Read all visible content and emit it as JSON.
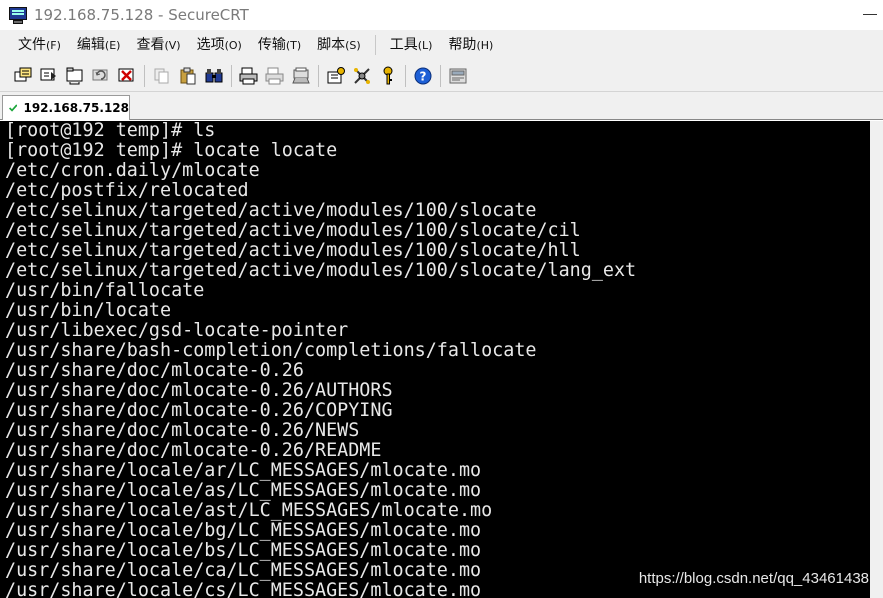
{
  "window": {
    "title": "192.168.75.128 - SecureCRT",
    "icon": "securecrt-app-icon"
  },
  "menu": [
    {
      "label": "文件",
      "key": "(F)"
    },
    {
      "label": "编辑",
      "key": "(E)"
    },
    {
      "label": "查看",
      "key": "(V)"
    },
    {
      "label": "选项",
      "key": "(O)"
    },
    {
      "label": "传输",
      "key": "(T)"
    },
    {
      "label": "脚本",
      "key": "(S)"
    },
    {
      "label": "工具",
      "key": "(L)"
    },
    {
      "label": "帮助",
      "key": "(H)"
    }
  ],
  "toolbar": {
    "icons": [
      "connect-icon",
      "quick-connect-icon",
      "connect-tab-icon",
      "reconnect-icon",
      "disconnect-icon",
      "copy-icon",
      "paste-icon",
      "find-icon",
      "print-icon",
      "print-selection-icon",
      "print-setup-icon",
      "session-options-icon",
      "global-options-icon",
      "keymap-icon",
      "help-icon",
      "sftp-icon"
    ]
  },
  "tabs": [
    {
      "label": "192.168.75.128",
      "icon": "check-icon",
      "active": true
    }
  ],
  "terminal": {
    "background": "#000000",
    "foreground": "#e8e8e8",
    "lines": [
      "[root@192 temp]# ls",
      "[root@192 temp]# locate locate",
      "/etc/cron.daily/mlocate",
      "/etc/postfix/relocated",
      "/etc/selinux/targeted/active/modules/100/slocate",
      "/etc/selinux/targeted/active/modules/100/slocate/cil",
      "/etc/selinux/targeted/active/modules/100/slocate/hll",
      "/etc/selinux/targeted/active/modules/100/slocate/lang_ext",
      "/usr/bin/fallocate",
      "/usr/bin/locate",
      "/usr/libexec/gsd-locate-pointer",
      "/usr/share/bash-completion/completions/fallocate",
      "/usr/share/doc/mlocate-0.26",
      "/usr/share/doc/mlocate-0.26/AUTHORS",
      "/usr/share/doc/mlocate-0.26/COPYING",
      "/usr/share/doc/mlocate-0.26/NEWS",
      "/usr/share/doc/mlocate-0.26/README",
      "/usr/share/locale/ar/LC_MESSAGES/mlocate.mo",
      "/usr/share/locale/as/LC_MESSAGES/mlocate.mo",
      "/usr/share/locale/ast/LC_MESSAGES/mlocate.mo",
      "/usr/share/locale/bg/LC_MESSAGES/mlocate.mo",
      "/usr/share/locale/bs/LC_MESSAGES/mlocate.mo",
      "/usr/share/locale/ca/LC_MESSAGES/mlocate.mo",
      "/usr/share/locale/cs/LC_MESSAGES/mlocate.mo"
    ]
  },
  "watermark": "https://blog.csdn.net/qq_43461438"
}
